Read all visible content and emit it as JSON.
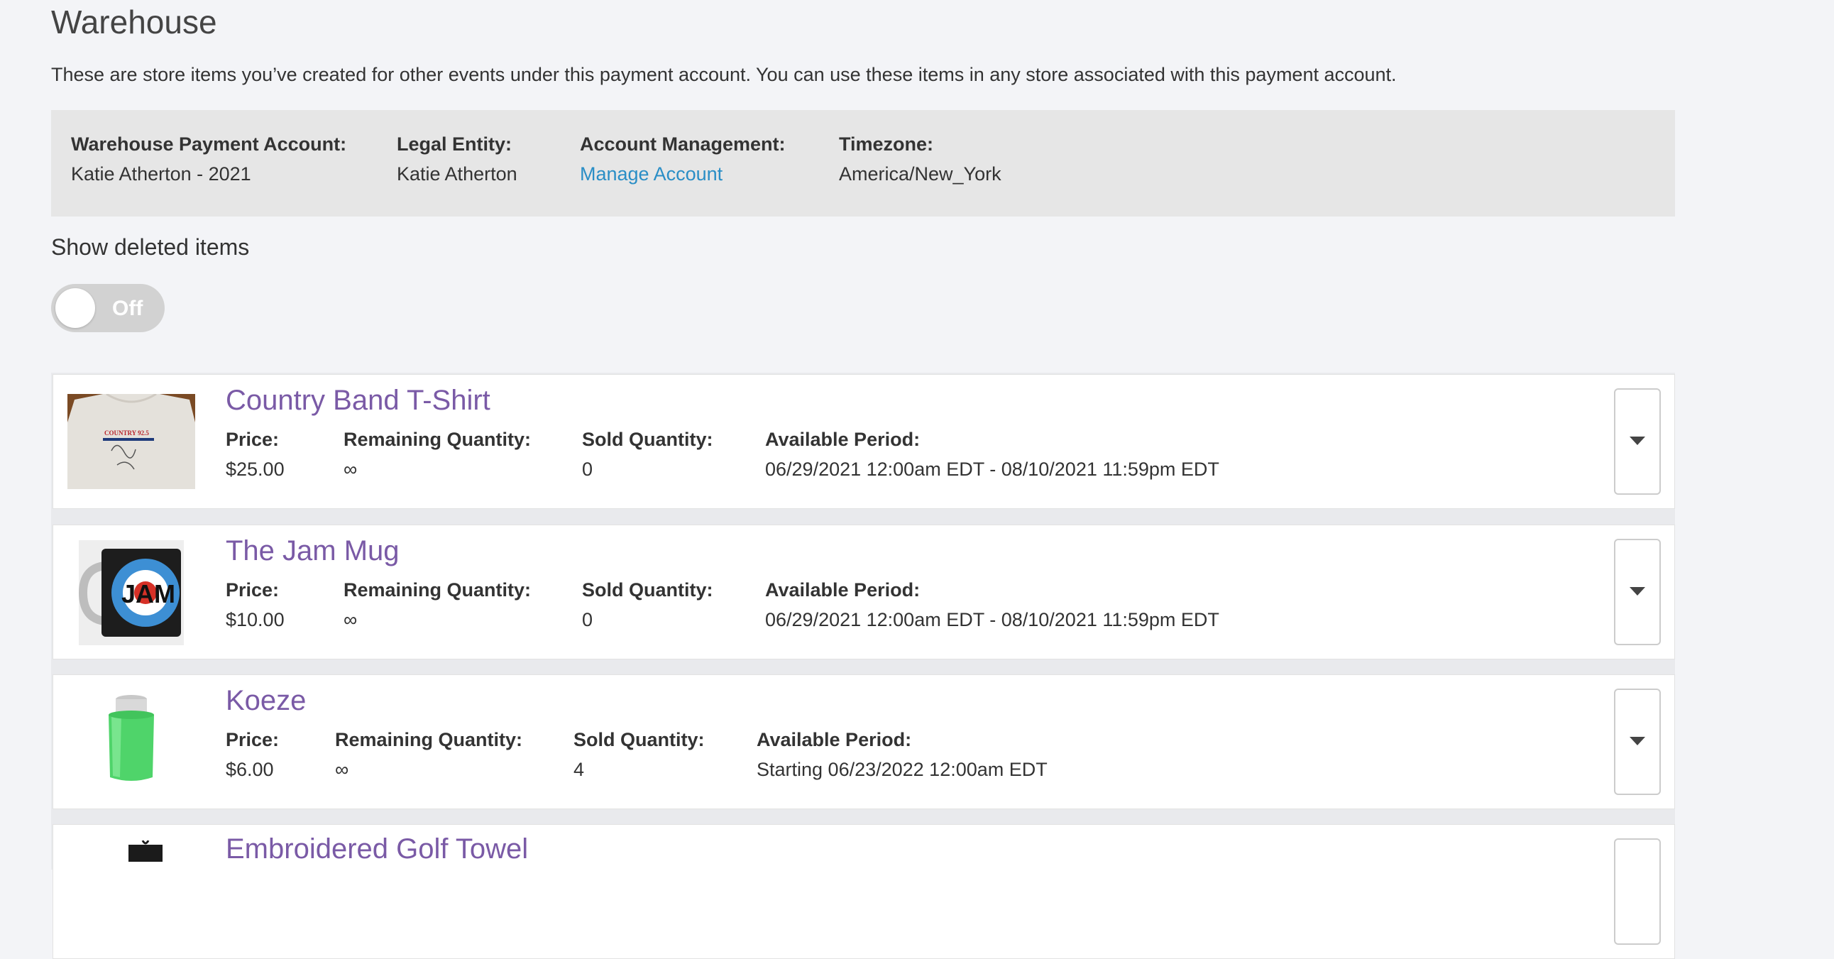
{
  "page": {
    "title": "Warehouse",
    "description": "These are store items you’ve created for other events under this payment account. You can use these items in any store associated with this payment account."
  },
  "account": {
    "payment_account_label": "Warehouse Payment Account:",
    "payment_account_value": "Katie Atherton - 2021",
    "legal_entity_label": "Legal Entity:",
    "legal_entity_value": "Katie Atherton",
    "management_label": "Account Management:",
    "management_link": "Manage Account",
    "timezone_label": "Timezone:",
    "timezone_value": "America/New_York"
  },
  "show_deleted": {
    "label": "Show deleted items",
    "toggle_state": "Off"
  },
  "labels": {
    "price": "Price:",
    "remaining": "Remaining Quantity:",
    "sold": "Sold Quantity:",
    "period": "Available Period:"
  },
  "items": [
    {
      "title": "Country Band T-Shirt",
      "price": "$25.00",
      "remaining": "∞",
      "sold": "0",
      "period": "06/29/2021 12:00am EDT - 08/10/2021 11:59pm EDT",
      "thumb_text": "COUNTRY 92.5"
    },
    {
      "title": "The Jam Mug",
      "price": "$10.00",
      "remaining": "∞",
      "sold": "0",
      "period": "06/29/2021 12:00am EDT - 08/10/2021 11:59pm EDT",
      "thumb_text": "JAM"
    },
    {
      "title": "Koeze",
      "price": "$6.00",
      "remaining": "∞",
      "sold": "4",
      "period": "Starting 06/23/2022 12:00am EDT"
    },
    {
      "title": "Embroidered Golf Towel"
    }
  ],
  "colors": {
    "accent_link": "#2a8ec6",
    "item_title": "#7a5aa6",
    "panel_bg": "#e6e6e6",
    "page_bg": "#f3f4f7"
  }
}
